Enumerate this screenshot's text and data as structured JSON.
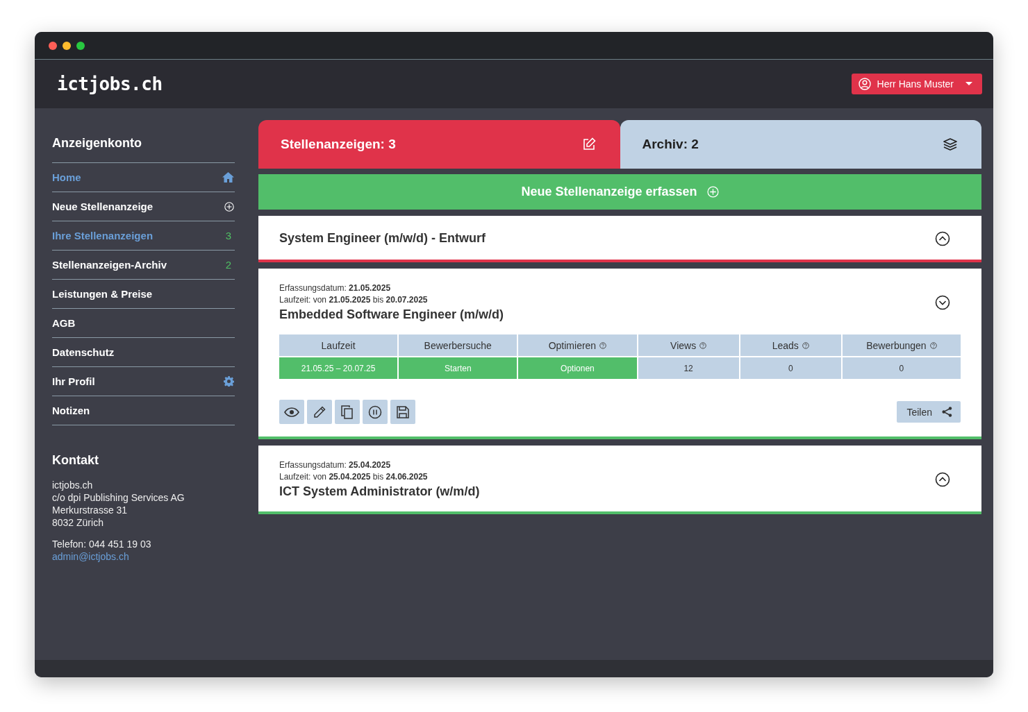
{
  "header": {
    "logo": "ictjobs.ch",
    "user_button": "Herr Hans Muster"
  },
  "sidebar": {
    "title": "Anzeigenkonto",
    "items": [
      {
        "label": "Home",
        "selected": true,
        "kind": "home"
      },
      {
        "label": "Neue Stellenanzeige",
        "selected": false,
        "kind": "add"
      },
      {
        "label": "Ihre Stellenanzeigen",
        "selected": true,
        "kind": "count",
        "count": "3"
      },
      {
        "label": "Stellenanzeigen-Archiv",
        "selected": false,
        "kind": "count",
        "count": "2"
      },
      {
        "label": "Leistungen & Preise",
        "selected": false,
        "kind": "plain"
      },
      {
        "label": "AGB",
        "selected": false,
        "kind": "plain"
      },
      {
        "label": "Datenschutz",
        "selected": false,
        "kind": "plain"
      },
      {
        "label": "Ihr Profil",
        "selected": false,
        "kind": "settings"
      },
      {
        "label": "Notizen",
        "selected": false,
        "kind": "plain"
      }
    ]
  },
  "contact": {
    "title": "Kontakt",
    "address": [
      "ictjobs.ch",
      "c/o dpi Publishing Services AG",
      "Merkurstrasse 31",
      "8032 Zürich"
    ],
    "phone": "Telefon: 044 451 19 03",
    "email": "admin@ictjobs.ch"
  },
  "tabs": [
    {
      "label": "Stellenanzeigen: 3",
      "selected": true
    },
    {
      "label": "Archiv: 2",
      "selected": false
    }
  ],
  "new_button": "Neue Stellenanzeige erfassen",
  "jobs": [
    {
      "kind": "draft",
      "title": "System Engineer (m/w/d) - Entwurf",
      "expanded": false
    },
    {
      "kind": "active",
      "created": "Erfassungsdatum: **21.05.2025**",
      "runtime": "Laufzeit: von **21.05.2025** bis **20.07.2025**",
      "title": "Embedded Software Engineer (m/w/d)",
      "expanded": true,
      "columns": [
        {
          "label": "Laufzeit",
          "help": false
        },
        {
          "label": "Bewerbersuche",
          "help": false
        },
        {
          "label": "Optimieren",
          "help": true
        },
        {
          "label": "Views",
          "help": true
        },
        {
          "label": "Leads",
          "help": true
        },
        {
          "label": "Bewerbungen",
          "help": true
        }
      ],
      "cells": [
        {
          "text": "21.05.25 – 20.07.25",
          "kind": "action"
        },
        {
          "text": "Starten",
          "kind": "action"
        },
        {
          "text": "Optionen",
          "kind": "action"
        },
        {
          "text": "12",
          "kind": "value"
        },
        {
          "text": "0",
          "kind": "value"
        },
        {
          "text": "0",
          "kind": "value"
        }
      ],
      "share_button": "Teilen"
    },
    {
      "kind": "active",
      "created": "Erfassungsdatum: **25.04.2025**",
      "runtime": "Laufzeit: von **25.04.2025** bis **24.06.2025**",
      "title": "ICT System Administrator (w/m/d)",
      "expanded": false
    }
  ]
}
